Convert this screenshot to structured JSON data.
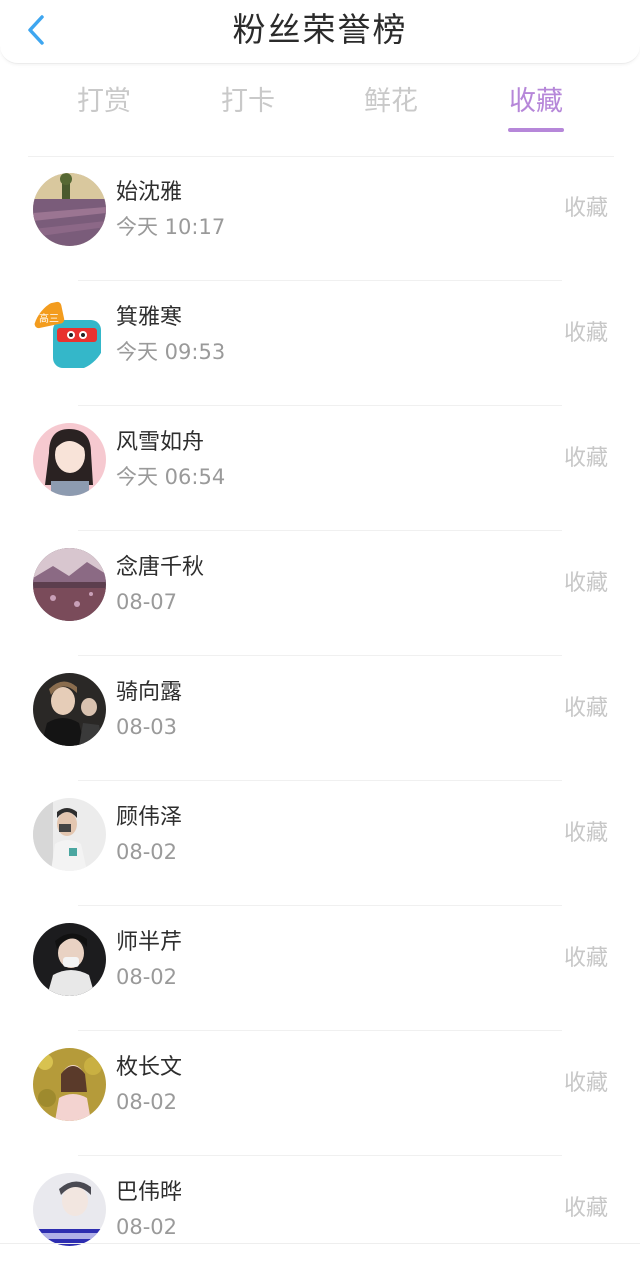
{
  "header": {
    "title": "粉丝荣誉榜",
    "back_icon": "chevron-left-icon"
  },
  "colors": {
    "accent": "#b687d9",
    "back_icon": "#3ea6f0"
  },
  "tabs": [
    {
      "label": "打赏",
      "active": false
    },
    {
      "label": "打卡",
      "active": false
    },
    {
      "label": "鲜花",
      "active": false
    },
    {
      "label": "收藏",
      "active": true
    }
  ],
  "fans": [
    {
      "name": "始沈雅",
      "time": "今天 10:17",
      "action": "收藏"
    },
    {
      "name": "箕雅寒",
      "time": "今天 09:53",
      "action": "收藏"
    },
    {
      "name": "风雪如舟",
      "time": "今天 06:54",
      "action": "收藏"
    },
    {
      "name": "念唐千秋",
      "time": "08-07",
      "action": "收藏"
    },
    {
      "name": "骑向露",
      "time": "08-03",
      "action": "收藏"
    },
    {
      "name": "顾伟泽",
      "time": "08-02",
      "action": "收藏"
    },
    {
      "name": "师半芹",
      "time": "08-02",
      "action": "收藏"
    },
    {
      "name": "枚长文",
      "time": "08-02",
      "action": "收藏"
    },
    {
      "name": "巴伟晔",
      "time": "08-02",
      "action": "收藏"
    }
  ]
}
